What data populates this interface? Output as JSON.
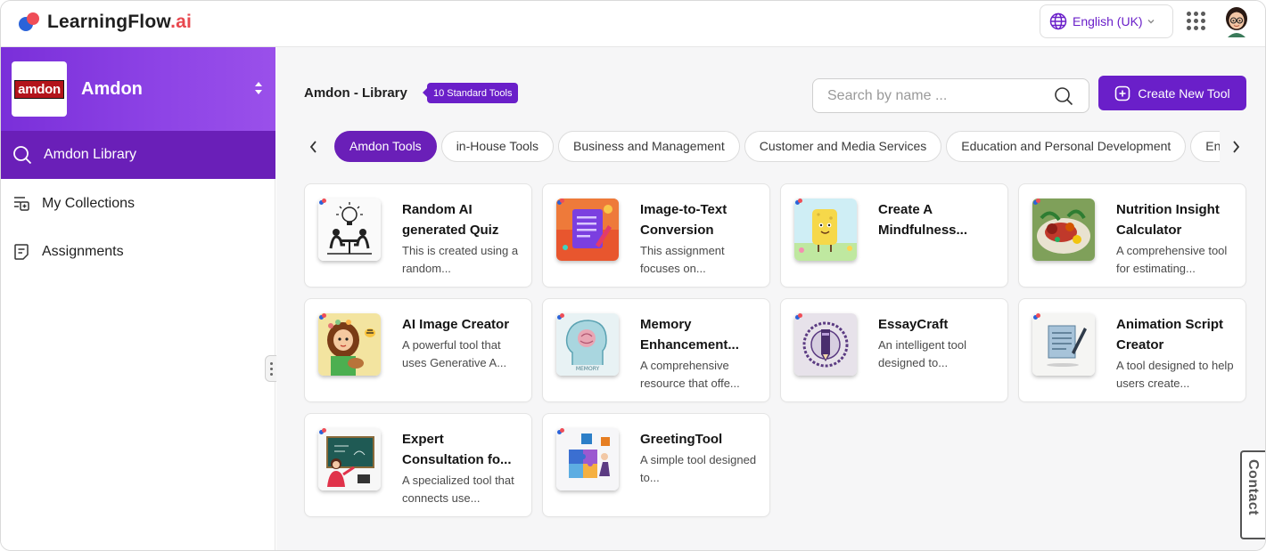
{
  "app": {
    "brand_main": "LearningFlow",
    "brand_suffix": ".ai",
    "accent_color": "#6a1fc9"
  },
  "header": {
    "language": "English (UK)"
  },
  "sidebar": {
    "org_logo_text": "amdon",
    "org_name": "Amdon",
    "items": [
      {
        "label": "Amdon Library",
        "icon": "search-icon"
      },
      {
        "label": "My Collections",
        "icon": "collections-icon"
      },
      {
        "label": "Assignments",
        "icon": "assignment-icon"
      }
    ]
  },
  "main": {
    "title": "Amdon - Library",
    "badge": "10 Standard Tools",
    "search_placeholder": "Search by name ...",
    "create_label": "Create New Tool",
    "chips": [
      "Amdon Tools",
      "in-House Tools",
      "Business and Management",
      "Customer and Media Services",
      "Education and Personal Development",
      "Entertainment"
    ],
    "active_chip": "Amdon Tools",
    "tools": [
      {
        "title": "Random AI generated Quiz",
        "desc": "This is created using a random...",
        "thumb": "quiz"
      },
      {
        "title": "Image-to-Text Conversion",
        "desc": "This assignment focuses on...",
        "thumb": "document"
      },
      {
        "title": "Create A Mindfulness...",
        "desc": "",
        "thumb": "sponge"
      },
      {
        "title": "Nutrition Insight Calculator",
        "desc": "A comprehensive tool for estimating...",
        "thumb": "food"
      },
      {
        "title": "AI Image Creator",
        "desc": "A powerful tool that uses Generative A...",
        "thumb": "girl"
      },
      {
        "title": "Memory Enhancement...",
        "desc": "A comprehensive resource that offe...",
        "thumb": "memory"
      },
      {
        "title": "EssayCraft",
        "desc": "An intelligent tool designed to...",
        "thumb": "pencil"
      },
      {
        "title": "Animation Script Creator",
        "desc": "A tool designed to help users create...",
        "thumb": "script"
      },
      {
        "title": "Expert Consultation fo...",
        "desc": "A specialized tool that connects use...",
        "thumb": "teacher"
      },
      {
        "title": "GreetingTool",
        "desc": "A simple tool designed to...",
        "thumb": "puzzle"
      }
    ]
  },
  "contact": {
    "label": "Contact"
  }
}
